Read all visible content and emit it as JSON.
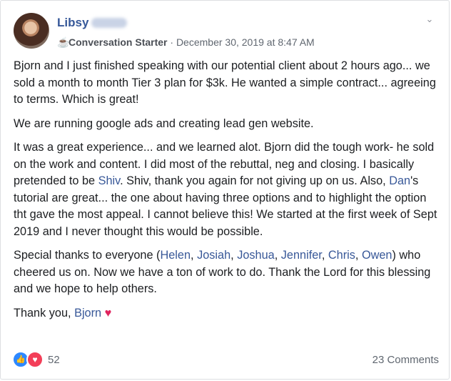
{
  "post": {
    "author_first": "Libsy",
    "badge": "Conversation Starter",
    "separator": "·",
    "timestamp": "December 30, 2019 at 8:47 AM",
    "icons": {
      "badge": "coffee-cup-icon",
      "menu": "chevron-down-icon"
    },
    "p1": "Bjorn and I just finished speaking with our potential client about 2 hours ago... we sold a month to month Tier 3 plan for $3k. He wanted a simple contract... agreeing to terms. Which is great!",
    "p2": "We are running google ads and creating lead gen website.",
    "p3": {
      "a": "It was a great experience... and we learned alot. Bjorn did the tough work- he sold on the work and content. I did most of the rebuttal, neg and closing. I basically pretended to be ",
      "shiv": "Shiv",
      "b": ". Shiv, thank you again for not giving up on us. Also, ",
      "dan": "Dan",
      "c": "'s tutorial are great... the one about having three options and to highlight the option tht gave the most appeal. I cannot believe this! We started at the first week of Sept 2019 and I never thought this would be possible."
    },
    "p4": {
      "a": "Special thanks to everyone (",
      "helen": "Helen",
      "josiah": "Josiah",
      "joshua": "Joshua",
      "jennifer": "Jennifer",
      "chris": "Chris",
      "owen": "Owen",
      "b": ") who cheered us on. Now we have a ton of work to do. Thank the Lord for this blessing and we hope to help others."
    },
    "p5": {
      "a": "Thank you, ",
      "bjorn": "Bjorn",
      "heart": "♥"
    }
  },
  "footer": {
    "reactions": [
      "like-icon",
      "love-icon"
    ],
    "reaction_count": "52",
    "comments": "23 Comments"
  },
  "colors": {
    "link": "#385898",
    "name": "#365899",
    "like": "#2d88ff",
    "love": "#f33e58"
  }
}
